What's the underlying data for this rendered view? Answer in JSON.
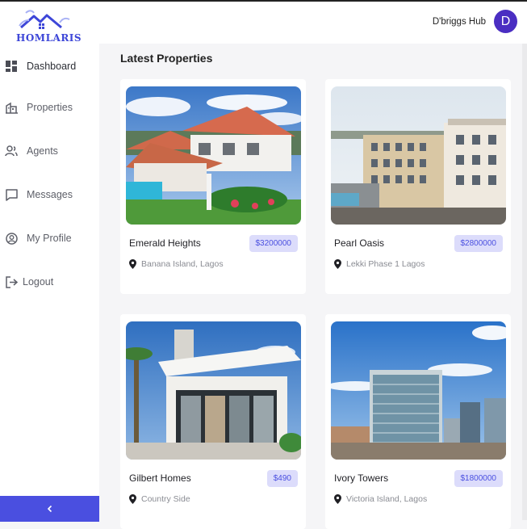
{
  "brand": {
    "name": "HOMLARIS"
  },
  "user": {
    "name": "D'briggs Hub",
    "initial": "D"
  },
  "sidebar": {
    "items": [
      {
        "label": "Dashboard",
        "icon": "dashboard-icon",
        "active": true
      },
      {
        "label": "Properties",
        "icon": "building-icon"
      },
      {
        "label": "Agents",
        "icon": "users-icon"
      },
      {
        "label": "Messages",
        "icon": "message-icon"
      },
      {
        "label": "My Profile",
        "icon": "profile-icon"
      },
      {
        "label": "Logout",
        "icon": "logout-icon"
      }
    ],
    "collapse_icon": "chevron-left-icon"
  },
  "main": {
    "title": "Latest Properties",
    "properties": [
      {
        "name": "Emerald Heights",
        "price": "$3200000",
        "location": "Banana Island, Lagos"
      },
      {
        "name": "Pearl Oasis",
        "price": "$2800000",
        "location": "Lekki Phase 1 Lagos"
      },
      {
        "name": "Gilbert Homes",
        "price": "$490",
        "location": "Country Side"
      },
      {
        "name": "Ivory Towers",
        "price": "$1800000",
        "location": "Victoria Island, Lagos"
      }
    ]
  },
  "colors": {
    "accent": "#4a4fe0",
    "avatar": "#4a2ec2",
    "price_bg": "#dcdcfb"
  }
}
